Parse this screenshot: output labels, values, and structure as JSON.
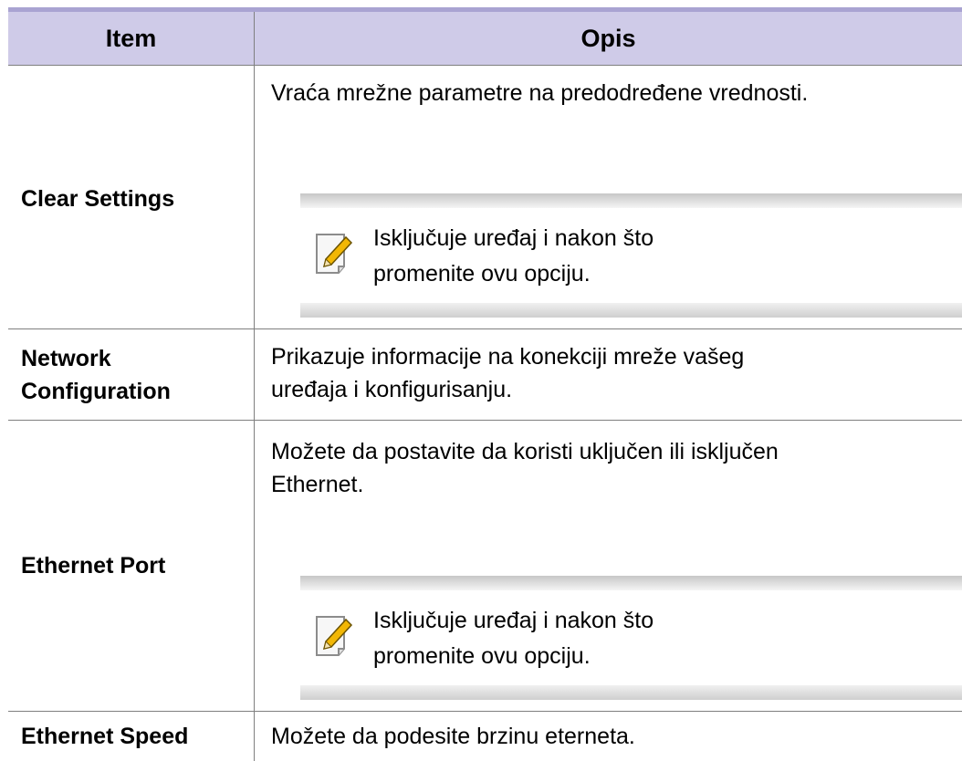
{
  "table": {
    "headers": {
      "item": "Item",
      "desc": "Opis"
    },
    "rows": [
      {
        "item": "Clear Settings",
        "desc": "Vraća mrežne parametre na predodređene vrednosti.",
        "note": "Isključuje uređaj i nakon što promenite ovu opciju."
      },
      {
        "item_line1": "Network",
        "item_line2": "Configuration",
        "desc_line1": "Prikazuje informacije na konekciji mreže vašeg",
        "desc_line2": "uređaja i konfigurisanju."
      },
      {
        "item": "Ethernet Port",
        "desc_line1": "Možete da postavite da koristi uključen ili isključen",
        "desc_line2": "Ethernet.",
        "note": "Isključuje uređaj i nakon što promenite ovu opciju."
      },
      {
        "item": "Ethernet Speed",
        "desc": "Možete da podesite brzinu eterneta."
      }
    ]
  },
  "icons": {
    "note": "note-pencil-icon"
  },
  "colors": {
    "header_bg": "#cfcbe8",
    "top_border": "#a9a3d2",
    "grid": "#7f7f7f",
    "pencil": "#f2b705"
  }
}
